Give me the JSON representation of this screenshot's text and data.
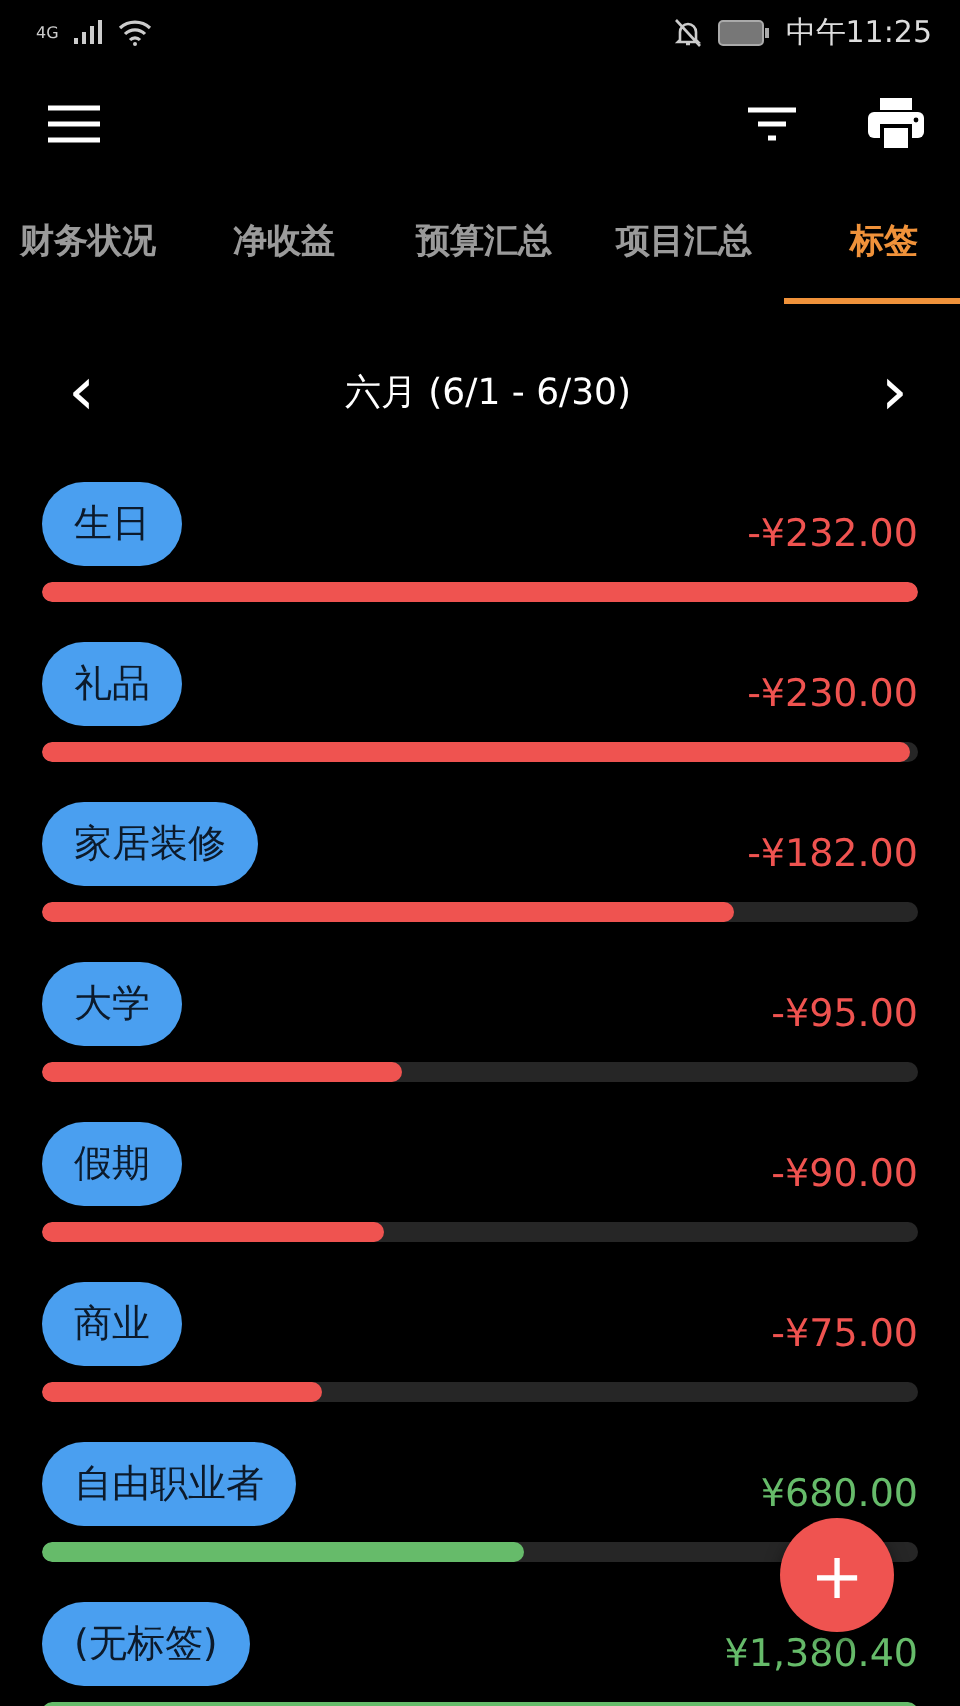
{
  "status_bar": {
    "network": "4G",
    "time": "中午11:25"
  },
  "tabs": [
    {
      "label": "财务状况",
      "selected": false
    },
    {
      "label": "净收益",
      "selected": false
    },
    {
      "label": "预算汇总",
      "selected": false
    },
    {
      "label": "项目汇总",
      "selected": false
    },
    {
      "label": "标签",
      "selected": true
    }
  ],
  "period": {
    "prev": "‹",
    "label": "六月 (6/1 - 6/30)",
    "next": "›"
  },
  "tags": [
    {
      "name": "生日",
      "amount": "-¥232.00",
      "kind": "expense",
      "level": 1
    },
    {
      "name": "礼品",
      "amount": "-¥230.00",
      "kind": "expense",
      "level": 0.99
    },
    {
      "name": "家居装修",
      "amount": "-¥182.00",
      "kind": "expense",
      "level": 0.79
    },
    {
      "name": "大学",
      "amount": "-¥95.00",
      "kind": "expense",
      "level": 0.41
    },
    {
      "name": "假期",
      "amount": "-¥90.00",
      "kind": "expense",
      "level": 0.39
    },
    {
      "name": "商业",
      "amount": "-¥75.00",
      "kind": "expense",
      "level": 0.32
    },
    {
      "name": "自由职业者",
      "amount": "¥680.00",
      "kind": "income",
      "level": 0.55
    },
    {
      "name": "(无标签)",
      "amount": "¥1,380.40",
      "kind": "income",
      "level": 1
    }
  ],
  "fab": {
    "label": "+"
  }
}
